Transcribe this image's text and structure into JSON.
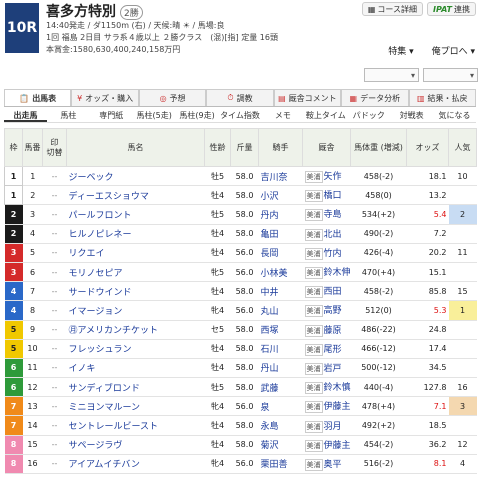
{
  "race": {
    "number": "10R",
    "name": "喜多方特別",
    "grade": "2勝",
    "line1": "14:40発走 / ダ1150m (右) / 天候:晴 ☀ / 馬場:良",
    "line2": "1回 福島 2日目 サラ系４歳以上 ２勝クラス　(混)[指] 定量 16頭",
    "line3": "本賞金:1580,630,400,240,158万円"
  },
  "top_buttons": {
    "course": "コース詳細",
    "ipat": "IPAT",
    "ipat_suffix": "連携"
  },
  "feature_links": {
    "tokusyu": "特集 ▾",
    "yoso": "俺プロへ ▾"
  },
  "dropdowns": [
    "▾",
    "▾"
  ],
  "tabs": [
    {
      "icon": "📋",
      "label": "出馬表"
    },
    {
      "icon": "¥",
      "label": "オッズ・購入"
    },
    {
      "icon": "◎",
      "label": "予想"
    },
    {
      "icon": "⏱",
      "label": "調教"
    },
    {
      "icon": "▤",
      "label": "厩舎コメント"
    },
    {
      "icon": "▦",
      "label": "データ分析"
    },
    {
      "icon": "▥",
      "label": "結果・払戻"
    }
  ],
  "subtabs": [
    "出走馬",
    "馬柱",
    "専門紙",
    "馬柱(5走)",
    "馬柱(9走)",
    "タイム指数",
    "メモ",
    "鞍上タイム",
    "パドック",
    "対戦表",
    "気になる"
  ],
  "headers": {
    "waku": "枠",
    "umaban": "馬番",
    "mark": "印",
    "select": "切替",
    "horse": "馬名",
    "sex": "性齢",
    "weight": "斤量",
    "jockey": "騎手",
    "trainer": "厩舎",
    "body": "馬体重 (増減)",
    "odds": "オッズ",
    "pop": "人気"
  },
  "waku_colors": {
    "1": "#ffffff",
    "2": "#1a1a1a",
    "3": "#d42a2a",
    "4": "#2a68c8",
    "5": "#f0c800",
    "6": "#2e9a3a",
    "7": "#f08a1a",
    "8": "#f08ab0"
  },
  "runners": [
    {
      "waku": "1",
      "num": "1",
      "horse": "ジーベック",
      "sex": "牡5",
      "weight": "58.0",
      "jockey": "吉川奈",
      "region": "美浦",
      "trainer": "矢作",
      "body": "458(-2)",
      "odds": "18.1",
      "pop": "10",
      "red": false
    },
    {
      "waku": "1",
      "num": "2",
      "horse": "ディーエスショウマ",
      "sex": "牡4",
      "weight": "58.0",
      "jockey": "小沢",
      "region": "美浦",
      "trainer": "橋口",
      "body": "458(0)",
      "odds": "13.2",
      "pop": "",
      "red": false
    },
    {
      "waku": "2",
      "num": "3",
      "horse": "パールフロント",
      "sex": "牡5",
      "weight": "58.0",
      "jockey": "丹内",
      "region": "美浦",
      "trainer": "寺島",
      "body": "534(+2)",
      "odds": "5.4",
      "pop": "2",
      "red": true
    },
    {
      "waku": "2",
      "num": "4",
      "horse": "ヒルノピレネー",
      "sex": "牡4",
      "weight": "58.0",
      "jockey": "亀田",
      "region": "美浦",
      "trainer": "北出",
      "body": "490(-2)",
      "odds": "7.2",
      "pop": "",
      "red": false
    },
    {
      "waku": "3",
      "num": "5",
      "horse": "リクエイ",
      "sex": "牡4",
      "weight": "56.0",
      "jockey": "長岡",
      "region": "美浦",
      "trainer": "竹内",
      "body": "426(-4)",
      "odds": "20.2",
      "pop": "11",
      "red": false
    },
    {
      "waku": "3",
      "num": "6",
      "horse": "モリノセピア",
      "sex": "牝5",
      "weight": "56.0",
      "jockey": "小林美",
      "region": "美浦",
      "trainer": "鈴木伸",
      "body": "470(+4)",
      "odds": "15.1",
      "pop": "",
      "red": false
    },
    {
      "waku": "4",
      "num": "7",
      "horse": "サードウインド",
      "sex": "牡4",
      "weight": "58.0",
      "jockey": "中井",
      "region": "美浦",
      "trainer": "西田",
      "body": "458(-2)",
      "odds": "85.8",
      "pop": "15",
      "red": false
    },
    {
      "waku": "4",
      "num": "8",
      "horse": "イマージョン",
      "sex": "牝4",
      "weight": "56.0",
      "jockey": "丸山",
      "region": "美浦",
      "trainer": "高野",
      "body": "512(0)",
      "odds": "5.3",
      "pop": "1",
      "red": true
    },
    {
      "waku": "5",
      "num": "9",
      "horse": "㊊アメリカンチケット",
      "sex": "セ5",
      "weight": "58.0",
      "jockey": "西塚",
      "region": "美浦",
      "trainer": "藤原",
      "body": "486(-22)",
      "odds": "24.8",
      "pop": "",
      "red": false
    },
    {
      "waku": "5",
      "num": "10",
      "horse": "フレッシュラン",
      "sex": "牡4",
      "weight": "58.0",
      "jockey": "石川",
      "region": "美浦",
      "trainer": "尾形",
      "body": "466(-12)",
      "odds": "17.4",
      "pop": "",
      "red": false
    },
    {
      "waku": "6",
      "num": "11",
      "horse": "イノキ",
      "sex": "牡4",
      "weight": "58.0",
      "jockey": "丹山",
      "region": "美浦",
      "trainer": "岩戸",
      "body": "500(-12)",
      "odds": "34.5",
      "pop": "",
      "red": false
    },
    {
      "waku": "6",
      "num": "12",
      "horse": "サンディブロンド",
      "sex": "牡5",
      "weight": "58.0",
      "jockey": "武藤",
      "region": "美浦",
      "trainer": "鈴木慎",
      "body": "440(-4)",
      "odds": "127.8",
      "pop": "16",
      "red": false
    },
    {
      "waku": "7",
      "num": "13",
      "horse": "ミニヨンマルーン",
      "sex": "牝4",
      "weight": "56.0",
      "jockey": "泉",
      "region": "美浦",
      "trainer": "伊藤主",
      "body": "478(+4)",
      "odds": "7.1",
      "pop": "3",
      "red": true
    },
    {
      "waku": "7",
      "num": "14",
      "horse": "セントレールビースト",
      "sex": "牡4",
      "weight": "58.0",
      "jockey": "永島",
      "region": "美浦",
      "trainer": "羽月",
      "body": "492(+2)",
      "odds": "18.5",
      "pop": "",
      "red": false
    },
    {
      "waku": "8",
      "num": "15",
      "horse": "サページラヴ",
      "sex": "牡4",
      "weight": "58.0",
      "jockey": "菊沢",
      "region": "美浦",
      "trainer": "伊藤主",
      "body": "454(-2)",
      "odds": "36.2",
      "pop": "12",
      "red": false
    },
    {
      "waku": "8",
      "num": "16",
      "horse": "アイアムイチバン",
      "sex": "牝4",
      "weight": "56.0",
      "jockey": "栗田善",
      "region": "美浦",
      "trainer": "奥平",
      "body": "516(-2)",
      "odds": "8.1",
      "pop": "4",
      "red": true
    }
  ]
}
